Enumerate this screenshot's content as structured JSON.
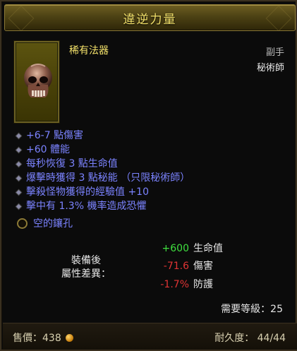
{
  "item": {
    "name": "違逆力量",
    "rarity": "稀有法器",
    "slot": "副手",
    "class": "秘術師",
    "icon": "skull-icon"
  },
  "affixes": [
    "+6-7 點傷害",
    "+60 體能",
    "每秒恢復 3 點生命值",
    "爆擊時獲得 3 點秘能 （只限秘術師）",
    "擊殺怪物獲得的經驗值 +10",
    "擊中有 1.3% 機率造成恐懼"
  ],
  "socket": {
    "label": "空的鑲孔"
  },
  "comparison": {
    "label_line1": "裝備後",
    "label_line2": "屬性差異：",
    "rows": [
      {
        "value": "+600",
        "name": "生命值",
        "color": "#3fe03f"
      },
      {
        "value": "-71.6",
        "name": "傷害",
        "color": "#e03434"
      },
      {
        "value": "-1.7%",
        "name": "防護",
        "color": "#e03434"
      }
    ]
  },
  "requirement": {
    "text": "需要等級：25"
  },
  "footer": {
    "sell_label": "售價：438",
    "durability_label": "耐久度： 44/44"
  },
  "colors": {
    "title": "#f4e26a",
    "affix": "#7b83ff",
    "positive": "#3fe03f",
    "negative": "#e03434"
  }
}
